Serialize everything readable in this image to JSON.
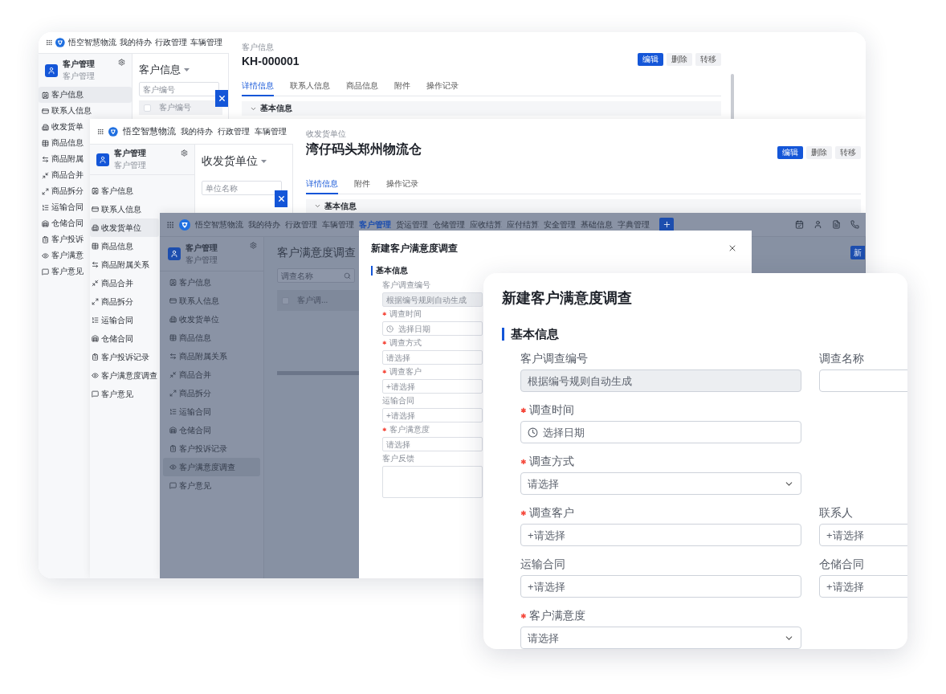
{
  "back_window": {
    "brand": "悟空智慧物流",
    "nav": [
      {
        "label": "我的待办",
        "selected": false
      },
      {
        "label": "行政管理",
        "selected": false
      },
      {
        "label": "车辆管理",
        "selected": false
      }
    ],
    "module": {
      "title": "客户管理",
      "subtitle": "客户管理"
    },
    "sidebar": [
      {
        "label": "客户信息",
        "selected": true
      },
      {
        "label": "联系人信息",
        "selected": false
      },
      {
        "label": "收发货单",
        "selected": false
      },
      {
        "label": "商品信息",
        "selected": false
      },
      {
        "label": "商品附属",
        "selected": false
      },
      {
        "label": "商品合并",
        "selected": false
      },
      {
        "label": "商品拆分",
        "selected": false
      },
      {
        "label": "运输合同",
        "selected": false
      },
      {
        "label": "仓储合同",
        "selected": false
      },
      {
        "label": "客户投诉",
        "selected": false
      },
      {
        "label": "客户满意",
        "selected": false
      },
      {
        "label": "客户意见",
        "selected": false
      }
    ],
    "list": {
      "title": "客户信息",
      "search": {
        "placeholder": "客户编号"
      },
      "column": "客户编号",
      "checked": false
    },
    "detail": {
      "caption": "客户信息",
      "title": "KH-000001",
      "actions": [
        {
          "label": "编辑",
          "kind": "primary"
        },
        {
          "label": "删除",
          "kind": "default"
        },
        {
          "label": "转移",
          "kind": "default"
        }
      ],
      "tabs": [
        {
          "label": "详情信息",
          "selected": true
        },
        {
          "label": "联系人信息",
          "selected": false
        },
        {
          "label": "商品信息",
          "selected": false
        },
        {
          "label": "附件",
          "selected": false
        },
        {
          "label": "操作记录",
          "selected": false
        }
      ],
      "section": "基本信息"
    }
  },
  "middle_window": {
    "brand": "悟空智慧物流",
    "nav": [
      {
        "label": "我的待办",
        "selected": false
      },
      {
        "label": "行政管理",
        "selected": false
      },
      {
        "label": "车辆管理",
        "selected": false
      }
    ],
    "module": {
      "title": "客户管理",
      "subtitle": "客户管理"
    },
    "sidebar": [
      {
        "label": "客户信息",
        "selected": false
      },
      {
        "label": "联系人信息",
        "selected": false
      },
      {
        "label": "收发货单位",
        "selected": true
      },
      {
        "label": "商品信息",
        "selected": false
      },
      {
        "label": "商品附属关系",
        "selected": false
      },
      {
        "label": "商品合并",
        "selected": false
      },
      {
        "label": "商品拆分",
        "selected": false
      },
      {
        "label": "运输合同",
        "selected": false
      },
      {
        "label": "仓储合同",
        "selected": false
      },
      {
        "label": "客户投诉记录",
        "selected": false
      },
      {
        "label": "客户满意度调查",
        "selected": false
      },
      {
        "label": "客户意见",
        "selected": false
      }
    ],
    "list": {
      "title": "收发货单位",
      "search": {
        "placeholder": "单位名称"
      }
    },
    "detail": {
      "caption": "收发货单位",
      "title": "湾仔码头郑州物流仓",
      "actions": [
        {
          "label": "编辑",
          "kind": "primary"
        },
        {
          "label": "删除",
          "kind": "default"
        },
        {
          "label": "转移",
          "kind": "default"
        }
      ],
      "tabs": [
        {
          "label": "详情信息",
          "selected": true
        },
        {
          "label": "附件",
          "selected": false
        },
        {
          "label": "操作记录",
          "selected": false
        }
      ],
      "section": "基本信息"
    }
  },
  "front_window": {
    "brand": "悟空智慧物流",
    "nav": [
      {
        "label": "我的待办",
        "selected": false
      },
      {
        "label": "行政管理",
        "selected": false
      },
      {
        "label": "车辆管理",
        "selected": false
      },
      {
        "label": "客户管理",
        "selected": true
      },
      {
        "label": "货运管理",
        "selected": false
      },
      {
        "label": "仓储管理",
        "selected": false
      },
      {
        "label": "应收结算",
        "selected": false
      },
      {
        "label": "应付结算",
        "selected": false
      },
      {
        "label": "安全管理",
        "selected": false
      },
      {
        "label": "基础信息",
        "selected": false
      },
      {
        "label": "字典管理",
        "selected": false
      }
    ],
    "module": {
      "title": "客户管理",
      "subtitle": "客户管理"
    },
    "sidebar": [
      {
        "label": "客户信息",
        "selected": false
      },
      {
        "label": "联系人信息",
        "selected": false
      },
      {
        "label": "收发货单位",
        "selected": false
      },
      {
        "label": "商品信息",
        "selected": false
      },
      {
        "label": "商品附属关系",
        "selected": false
      },
      {
        "label": "商品合并",
        "selected": false
      },
      {
        "label": "商品拆分",
        "selected": false
      },
      {
        "label": "运输合同",
        "selected": false
      },
      {
        "label": "仓储合同",
        "selected": false
      },
      {
        "label": "客户投诉记录",
        "selected": false
      },
      {
        "label": "客户满意度调查",
        "selected": true
      },
      {
        "label": "客户意见",
        "selected": false
      }
    ],
    "list": {
      "title": "客户满意度调查",
      "search": {
        "placeholder": "调查名称"
      },
      "column": "客户调...",
      "checked": false
    },
    "new_button": "新",
    "modal": {
      "title": "新建客户满意度调查",
      "section": "基本信息",
      "fields": [
        {
          "label": "客户调查编号",
          "required": false,
          "kind": "text",
          "placeholder": "根据编号规则自动生成",
          "disabled": true
        },
        {
          "label": "调查时间",
          "required": true,
          "kind": "date",
          "placeholder": "选择日期",
          "disabled": false
        },
        {
          "label": "调查方式",
          "required": true,
          "kind": "select",
          "placeholder": "请选择",
          "disabled": false
        },
        {
          "label": "调查客户",
          "required": true,
          "kind": "text",
          "placeholder": "+请选择",
          "disabled": false
        },
        {
          "label": "运输合同",
          "required": false,
          "kind": "text",
          "placeholder": "+请选择",
          "disabled": false
        },
        {
          "label": "客户满意度",
          "required": true,
          "kind": "select",
          "placeholder": "请选择",
          "disabled": false
        },
        {
          "label": "客户反馈",
          "required": false,
          "kind": "textarea",
          "disabled": false
        }
      ]
    }
  },
  "zoom_card": {
    "title": "新建客户满意度调查",
    "section": "基本信息",
    "rows": [
      {
        "left": {
          "label": "客户调查编号",
          "required": false,
          "kind": "text",
          "placeholder": "根据编号规则自动生成",
          "disabled": true
        },
        "right": {
          "label": "调查名称",
          "required": false,
          "kind": "text",
          "disabled": false
        }
      },
      {
        "left": {
          "label": "调查时间",
          "required": true,
          "kind": "date",
          "placeholder": "选择日期",
          "disabled": false
        }
      },
      {
        "left": {
          "label": "调查方式",
          "required": true,
          "kind": "select",
          "placeholder": "请选择",
          "disabled": false
        }
      },
      {
        "left": {
          "label": "调查客户",
          "required": true,
          "kind": "text",
          "placeholder": "+请选择",
          "disabled": false
        },
        "right": {
          "label": "联系人",
          "required": false,
          "kind": "text",
          "placeholder": "+请选择",
          "disabled": false
        }
      },
      {
        "left": {
          "label": "运输合同",
          "required": false,
          "kind": "text",
          "placeholder": "+请选择",
          "disabled": false
        },
        "right": {
          "label": "仓储合同",
          "required": false,
          "kind": "text",
          "placeholder": "+请选择",
          "disabled": false
        }
      },
      {
        "left": {
          "label": "客户满意度",
          "required": true,
          "kind": "select",
          "placeholder": "请选择",
          "disabled": false
        }
      }
    ]
  }
}
